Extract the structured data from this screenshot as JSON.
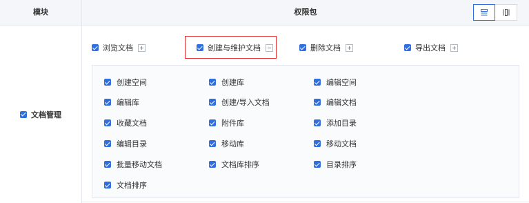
{
  "header": {
    "module_col": "模块",
    "perm_col": "权限包"
  },
  "view_toggle": {
    "options": [
      "list-view-icon",
      "columns-view-icon"
    ],
    "active": "list-view-icon"
  },
  "module": {
    "label": "文档管理",
    "checked": true
  },
  "top_permissions": [
    {
      "label": "浏览文档",
      "checked": true,
      "expander": "plus"
    },
    {
      "label": "创建与维护文档",
      "checked": true,
      "expander": "minus",
      "highlighted": true
    },
    {
      "label": "删除文档",
      "checked": true,
      "expander": "plus"
    },
    {
      "label": "导出文档",
      "checked": true,
      "expander": "plus"
    }
  ],
  "sub_permissions": [
    [
      "创建空间",
      "创建库",
      "编辑空间"
    ],
    [
      "编辑库",
      "创建/导入文档",
      "编辑文档"
    ],
    [
      "收藏文档",
      "附件库",
      "添加目录"
    ],
    [
      "编辑目录",
      "移动库",
      "移动文档"
    ],
    [
      "批量移动文档",
      "文档库排序",
      "目录排序"
    ],
    [
      "文档排序"
    ]
  ],
  "colors": {
    "accent": "#2f6fe0",
    "highlight_border": "#e03030"
  }
}
